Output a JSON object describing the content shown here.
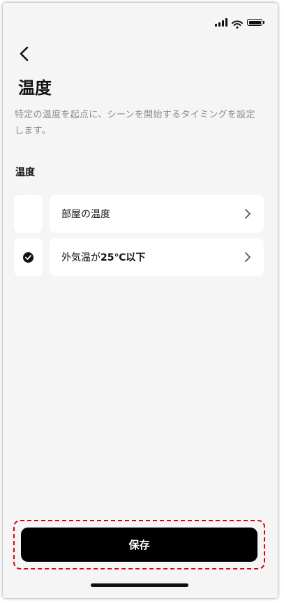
{
  "header": {
    "back_icon": "chevron-left-icon",
    "title": "温度"
  },
  "description": "特定の温度を起点に、シーンを開始するタイミングを設定します。",
  "section": {
    "label": "温度"
  },
  "options": [
    {
      "label": "部屋の温度",
      "label_bold": "",
      "checked": false,
      "chevron": "chevron-right-icon"
    },
    {
      "label": "外気温が",
      "label_bold": "25℃以下",
      "checked": true,
      "chevron": "chevron-right-icon"
    }
  ],
  "save_button": {
    "label": "保存",
    "highlight_color": "#e00000"
  },
  "status_bar": {
    "icons": [
      "cellular-signal-icon",
      "wifi-icon",
      "battery-icon"
    ]
  }
}
